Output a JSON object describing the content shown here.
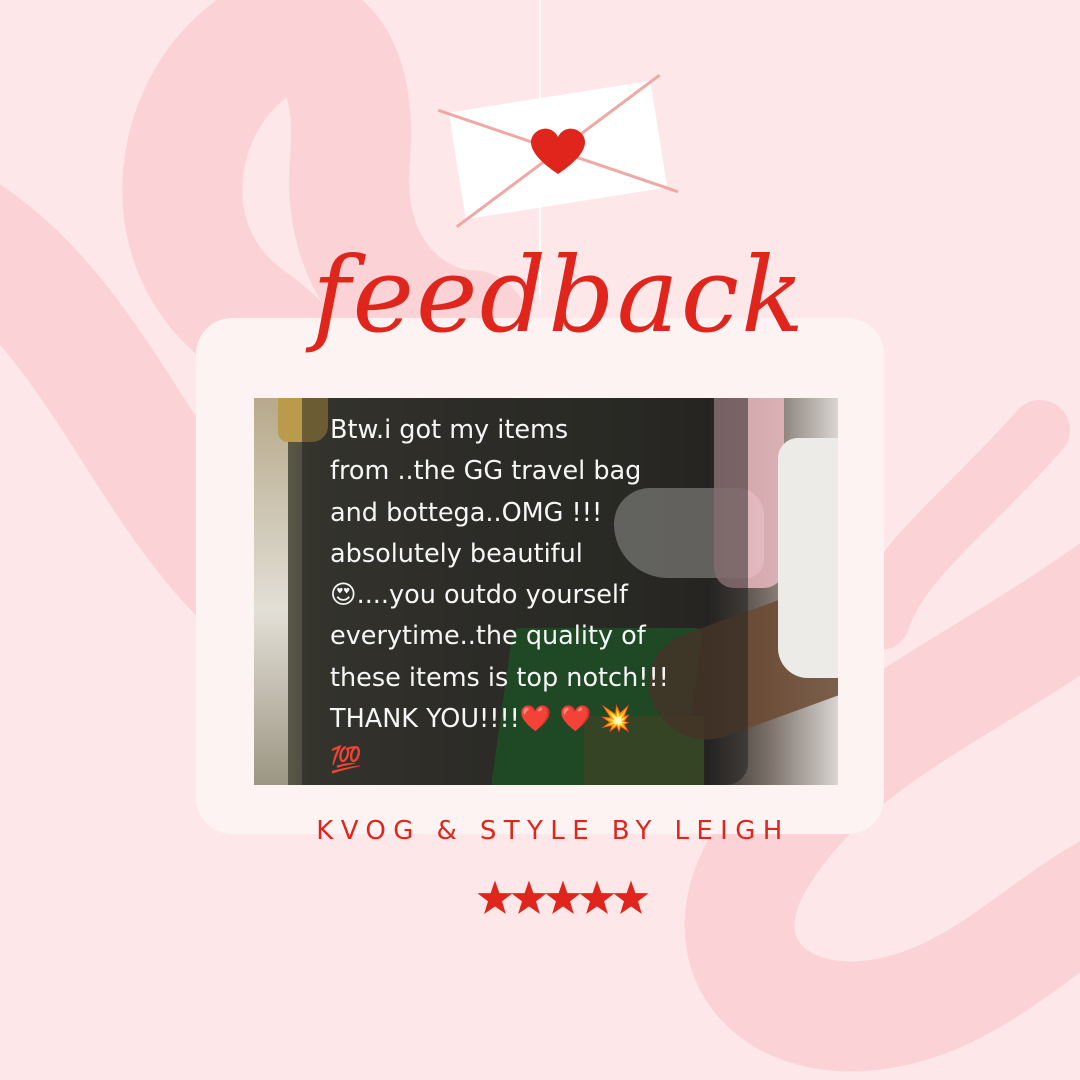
{
  "title": "feedback",
  "review": {
    "text": "Btw.i got my items\nfrom ..the GG travel bag\nand bottega..OMG !!!\nabsolutely beautiful\n😍....you outdo yourself\neverytime..the quality of\nthese items is top notch!!!\nTHANK YOU!!!!❤️ ❤️ 💥\n💯"
  },
  "signature": "KVOG & STYLE BY LEIGH",
  "rating": {
    "stars": 5,
    "max": 5
  },
  "colors": {
    "background": "#fde7e8",
    "swirl": "#fbd3d6",
    "accent_red": "#e0261c",
    "card": "#fdf3f2",
    "envelope_line": "#f0a8a4"
  },
  "icons": {
    "envelope": "envelope-icon",
    "heart": "heart-icon",
    "star": "star-icon"
  }
}
